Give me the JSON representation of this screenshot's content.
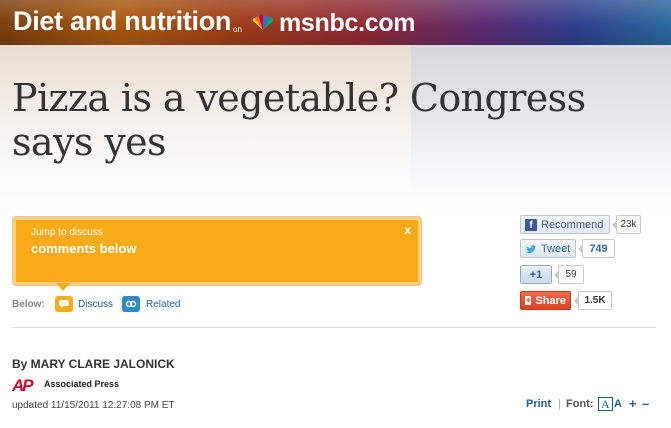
{
  "header": {
    "section_title": "Diet and nutrition",
    "on_text": "on",
    "brand": "msnbc.com",
    "peacock_icon": "nbc-peacock-icon"
  },
  "article": {
    "headline_line1": "Pizza is a vegetable? Congress",
    "headline_line2": "says yes",
    "byline": "By MARY CLARE JALONICK",
    "agency_logo": "AP",
    "agency": "Associated Press",
    "updated": "updated 11/15/2011 12:27:08 PM ET"
  },
  "discuss": {
    "small": "Jump to discuss",
    "big": "comments below",
    "close": "x"
  },
  "below": {
    "label": "Below:",
    "discuss_link": "Discuss",
    "related_link": "Related"
  },
  "social": {
    "recommend_label": "Recommend",
    "recommend_count": "23k",
    "tweet_label": "Tweet",
    "tweet_count": "749",
    "plusone_label": "+1",
    "plusone_count": "59",
    "share_label": "Share",
    "share_count": "1.5K"
  },
  "tools": {
    "print": "Print",
    "separator": "|",
    "font_label": "Font:",
    "font_glyphs": "A",
    "font_small": "A",
    "increase": "+",
    "decrease": "–"
  },
  "colors": {
    "discuss_orange": "#f9aa18",
    "link_blue": "#1a5e9a",
    "share_red": "#e04c2f",
    "ap_red": "#c8102e"
  }
}
